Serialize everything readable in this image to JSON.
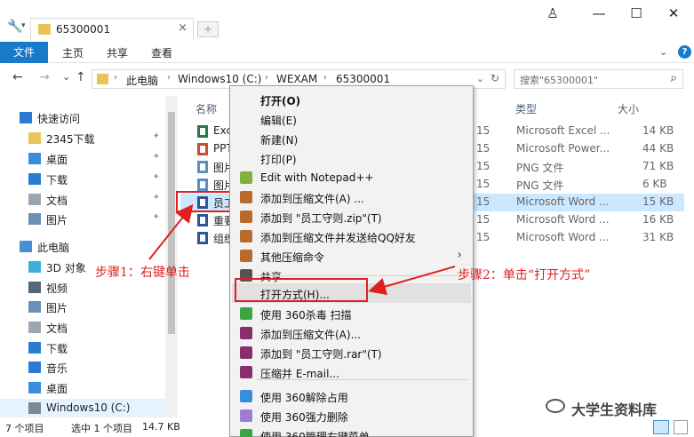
{
  "window": {
    "tab_title": "65300001",
    "tab_close": "×",
    "new_tab": "+",
    "user_icon": "♙",
    "min": "—",
    "max": "☐",
    "close": "✕"
  },
  "ribbon": {
    "tabs": [
      "文件",
      "主页",
      "共享",
      "查看"
    ],
    "expand": "⌄",
    "help": "?"
  },
  "nav": {
    "back": "←",
    "forward": "→",
    "recent": "⌄",
    "up": "↑",
    "crumbs": [
      "此电脑",
      "Windows10 (C:)",
      "WEXAM",
      "65300001"
    ],
    "sep": "›",
    "dropdown": "⌄",
    "refresh": "↻",
    "search_placeholder": "搜索\"65300001\"",
    "search_icon": "⌕"
  },
  "sidebar": {
    "items": [
      {
        "label": "快速访问",
        "icon": "star-icon",
        "pinned": false
      },
      {
        "label": "2345下载",
        "icon": "folder-icon",
        "pinned": true
      },
      {
        "label": "桌面",
        "icon": "desktop-icon",
        "pinned": true
      },
      {
        "label": "下载",
        "icon": "download-icon",
        "pinned": true
      },
      {
        "label": "文档",
        "icon": "document-icon",
        "pinned": true
      },
      {
        "label": "图片",
        "icon": "picture-icon",
        "pinned": true
      },
      {
        "label": "此电脑",
        "icon": "pc-icon",
        "pinned": false
      },
      {
        "label": "3D 对象",
        "icon": "cube-icon",
        "pinned": false
      },
      {
        "label": "视频",
        "icon": "video-icon",
        "pinned": false
      },
      {
        "label": "图片",
        "icon": "picture-icon",
        "pinned": false
      },
      {
        "label": "文档",
        "icon": "document-icon",
        "pinned": false
      },
      {
        "label": "下载",
        "icon": "download-icon",
        "pinned": false
      },
      {
        "label": "音乐",
        "icon": "music-icon",
        "pinned": false
      },
      {
        "label": "桌面",
        "icon": "desktop-icon",
        "pinned": false
      },
      {
        "label": "Windows10 (C:)",
        "icon": "drive-icon",
        "pinned": false
      }
    ],
    "pin_glyph": "📌"
  },
  "list": {
    "headers": {
      "name": "名称",
      "type": "类型",
      "size": "大小"
    },
    "rows": [
      {
        "name": "Exc",
        "time": "15",
        "type": "Microsoft Excel ...",
        "size": "14 KB",
        "icon": "excel-icon",
        "selected": false
      },
      {
        "name": "PPT",
        "time": "15",
        "type": "Microsoft Power...",
        "size": "44 KB",
        "icon": "ppt-icon",
        "selected": false
      },
      {
        "name": "图片",
        "time": "15",
        "type": "PNG 文件",
        "size": "71 KB",
        "icon": "png-icon",
        "selected": false
      },
      {
        "name": "图片",
        "time": "15",
        "type": "PNG 文件",
        "size": "6 KB",
        "icon": "png-icon",
        "selected": false
      },
      {
        "name": "员工",
        "time": "15",
        "type": "Microsoft Word ...",
        "size": "15 KB",
        "icon": "word-icon",
        "selected": true
      },
      {
        "name": "重要",
        "time": "15",
        "type": "Microsoft Word ...",
        "size": "16 KB",
        "icon": "word-icon",
        "selected": false
      },
      {
        "name": "组织",
        "time": "15",
        "type": "Microsoft Word ...",
        "size": "31 KB",
        "icon": "word-icon",
        "selected": false
      }
    ]
  },
  "context_menu": {
    "items": [
      {
        "label": "打开(O)",
        "bold": true,
        "icon": ""
      },
      {
        "label": "编辑(E)",
        "icon": ""
      },
      {
        "label": "新建(N)",
        "icon": ""
      },
      {
        "label": "打印(P)",
        "icon": ""
      },
      {
        "label": "Edit with Notepad++",
        "icon": "notepad-icon"
      },
      {
        "label": "添加到压缩文件(A) ...",
        "icon": "archive-icon"
      },
      {
        "label": "添加到 \"员工守则.zip\"(T)",
        "icon": "archive-icon"
      },
      {
        "label": "添加到压缩文件并发送给QQ好友",
        "icon": "archive-icon"
      },
      {
        "label": "其他压缩命令",
        "icon": "archive-icon",
        "submenu": true
      },
      {
        "label": "共享",
        "icon": "share-icon"
      },
      {
        "label": "打开方式(H)...",
        "icon": "",
        "highlight": true
      },
      {
        "label": "使用 360杀毒 扫描",
        "icon": "shield-icon"
      },
      {
        "label": "添加到压缩文件(A)...",
        "icon": "rar-icon"
      },
      {
        "label": "添加到 \"员工守则.rar\"(T)",
        "icon": "rar-icon"
      },
      {
        "label": "压缩并 E-mail...",
        "icon": "rar-icon"
      },
      {
        "label": "使用 360解除占用",
        "icon": "unlock-icon"
      },
      {
        "label": "使用 360强力删除",
        "icon": "delete-icon"
      },
      {
        "label": "使用 360管理右键菜单",
        "icon": "menu-manage-icon"
      }
    ],
    "submenu_arrow": "›"
  },
  "annotations": {
    "step1": "步骤1：右键单击",
    "step2": "步骤2：单击“打开方式”"
  },
  "status": {
    "count": "7 个项目",
    "selected": "选中 1 个项目",
    "size": "14.7 KB"
  },
  "watermark": "大学生资料库",
  "colors": {
    "accent": "#1979ca",
    "selection": "#cce8ff",
    "annotation": "#e02020",
    "menu_bg": "#f2f2f2"
  }
}
